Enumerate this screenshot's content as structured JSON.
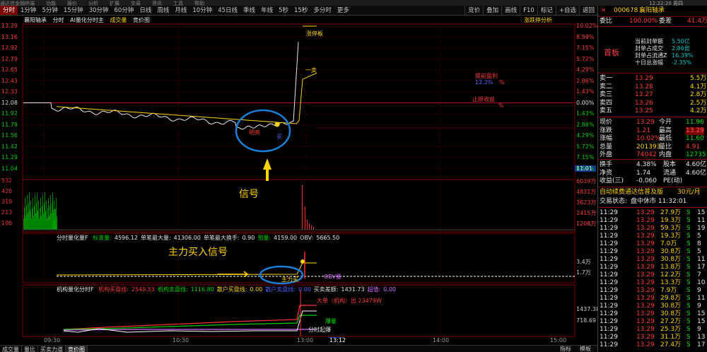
{
  "window": {
    "menu": [
      "通达信金融终端",
      "功能",
      "报价",
      "分析",
      "扩展",
      "交易",
      "资讯",
      "工具",
      "帮助"
    ],
    "clock": "12:22:20 周四"
  },
  "toolbar": {
    "periods": [
      "分时",
      "1分钟",
      "5分钟",
      "15分钟",
      "30分钟",
      "60分钟",
      "日线",
      "周线",
      "月线",
      "10分钟",
      "45日线",
      "季线",
      "年线",
      "5秒",
      "15秒",
      "多分时",
      "更多"
    ],
    "right_buttons": [
      "竞价",
      "叠加",
      "画线",
      "F10",
      "标记",
      "+自选",
      "返回"
    ]
  },
  "chart_header": {
    "name": "襄阳轴承",
    "mode": "分时",
    "indicator": "AI量化分时主",
    "volume_label": "成交量",
    "auction": "竞价图",
    "right_link": "涨跌停分析"
  },
  "price_axis_left": [
    "13.29",
    "13.16",
    "12.92",
    "12.79",
    "12.65",
    "12.43",
    "12.33",
    "12.08",
    "11.92",
    "11.79",
    "11.56",
    "11.42",
    "11.29",
    "11.04"
  ],
  "price_axis_right": [
    "10.02%",
    "8.59%",
    "7.15%",
    "5.72%",
    "4.29%",
    "2.86%",
    "1.43%",
    "0.00%",
    "1.43%",
    "2.86%",
    "4.29%",
    "5.72%",
    "7.15%",
    "8.59%"
  ],
  "price_cursor": "11.01",
  "volume_axis_left": [
    "532",
    "426",
    "319",
    "213",
    "106"
  ],
  "volume_axis_right": [
    "6039万",
    "4831万",
    "3623万",
    "2415万",
    "1208万"
  ],
  "chart_annotations": {
    "signal": "信号",
    "main_buy_signal": "主力买入信号",
    "bright_line": "明亮",
    "buy_mark": "买",
    "one_sell": "一卖",
    "limit_board": "涨停板",
    "up_limit_win": "提前盈利",
    "up_limit_pct": "12.2%",
    "up_limit_unit": "%",
    "dn_limit_win": "止损收益",
    "dn_limit_unit": "%"
  },
  "panel2": {
    "title": "分时量化量F",
    "fields": [
      {
        "label": "标准量:",
        "value": "4596.12"
      },
      {
        "label": "单笔最大量:",
        "value": "41306.00"
      },
      {
        "label": "单笔最大换手:",
        "value": "0.90"
      },
      {
        "label": "预量:",
        "value": "4159.00"
      },
      {
        "label": "OBV:",
        "value": "5665.50"
      }
    ],
    "axis_right": [
      "3.4万",
      "1.7万"
    ],
    "marks": {
      "main_buy": "主力买",
      "obv": "OBV量"
    }
  },
  "panel3": {
    "title": "机构量化分时F",
    "fields": [
      {
        "label": "机构买盘线:",
        "value": "2549.53"
      },
      {
        "label": "机构卖盘线:",
        "value": "1116.80"
      },
      {
        "label": "散户买盘线:",
        "value": "0.00"
      },
      {
        "label": "散户卖盘线:",
        "value": "0.00"
      },
      {
        "label": "买卖差额:",
        "value": "1431.73"
      },
      {
        "label": "超值:",
        "value": "0.00"
      }
    ],
    "axis_right": [
      "1437.38",
      "718.69"
    ],
    "marks": {
      "big_order": "大单（机构）出 23479W",
      "explode": "爆量",
      "break": "分时起爆"
    }
  },
  "time_axis": [
    "09:30",
    "10:30",
    "13:00",
    "13:12",
    "14:00",
    "15:00"
  ],
  "bottom_tabs": [
    "成交量",
    "量比",
    "买卖力道",
    "竞价图"
  ],
  "bottom_right": [
    "指标",
    "模板"
  ],
  "quote": {
    "code": "000678",
    "name": "襄阳轴承",
    "wei_bi_label": "委比",
    "wei_bi": "100.00%",
    "wei_cha_label": "委差",
    "wei_cha": "41.4万",
    "board_label": "首板",
    "seal_info": [
      {
        "label": "当前封单额",
        "value": "5.50亿"
      },
      {
        "label": "封单占成交",
        "value": "2.86倍"
      },
      {
        "label": "封单占流通Z",
        "value": "16.39%"
      },
      {
        "label": "十日总涨幅",
        "value": "-2.35%"
      }
    ],
    "sells": [
      {
        "label": "卖一",
        "price": "13.29",
        "vol": "5.5万"
      },
      {
        "label": "卖二",
        "price": "13.28",
        "vol": "4.1万"
      },
      {
        "label": "卖三",
        "price": "13.27",
        "vol": "2.8万"
      },
      {
        "label": "卖四",
        "price": "13.26",
        "vol": "2.5万"
      },
      {
        "label": "卖五",
        "price": "13.25",
        "vol": "4.2万"
      }
    ],
    "stats": [
      {
        "l1": "现价",
        "v1": "13.29",
        "l2": "今开",
        "v2": "11.96"
      },
      {
        "l1": "涨跌",
        "v1": "1.21",
        "l2": "最高",
        "v2": "13.29"
      },
      {
        "l1": "涨幅",
        "v1": "10.02%",
        "l2": "最低",
        "v2": "11.60"
      },
      {
        "l1": "总量",
        "v1": "201393",
        "l2": "量比",
        "v2": "4.91"
      },
      {
        "l1": "外盘",
        "v1": "74042",
        "l2": "内盘",
        "v2": "127351"
      }
    ],
    "stats2": [
      {
        "l1": "换手",
        "v1": "4.38%",
        "l2": "股本",
        "v2": "4.60亿"
      },
      {
        "l1": "净资",
        "v1": "1.74",
        "l2": "流通",
        "v2": "4.60亿"
      },
      {
        "l1": "收益(三)",
        "v1": "-0.060",
        "l2": "PE(动)",
        "v2": ""
      }
    ],
    "ad_text": "自动续费通达信普及版",
    "ad_price": "30元/月",
    "status_label": "交易状态:",
    "status": "盘中休市 11:32:01",
    "ticks": [
      {
        "t": "11:29",
        "p": "13.29",
        "v": "27.9万",
        "d": "S",
        "n": "15"
      },
      {
        "t": "11:29",
        "p": "13.29",
        "v": "19.3万",
        "d": "S",
        "n": "11"
      },
      {
        "t": "11:29",
        "p": "13.29",
        "v": "59.3万",
        "d": "S",
        "n": "19"
      },
      {
        "t": "11:29",
        "p": "13.29",
        "v": "19.3万",
        "d": "S",
        "n": "5"
      },
      {
        "t": "11:29",
        "p": "13.29",
        "v": "7.0万",
        "d": "S",
        "n": "8"
      },
      {
        "t": "11:29",
        "p": "13.29",
        "v": "30.8万",
        "d": "S",
        "n": "5"
      },
      {
        "t": "11:29",
        "p": "13.29",
        "v": "30.8万",
        "d": "S",
        "n": "11"
      },
      {
        "t": "11:29",
        "p": "13.29",
        "v": "13.8万",
        "d": "S",
        "n": "17"
      },
      {
        "t": "11:29",
        "p": "13.29",
        "v": "12.2万",
        "d": "S",
        "n": "7"
      },
      {
        "t": "11:29",
        "p": "13.29",
        "v": "13.3万",
        "d": "S",
        "n": "10"
      },
      {
        "t": "11:29",
        "p": "13.29",
        "v": "7.9万",
        "d": "S",
        "n": "9"
      },
      {
        "t": "11:29",
        "p": "13.29",
        "v": "29.8万",
        "d": "S",
        "n": "11"
      },
      {
        "t": "11:29",
        "p": "13.29",
        "v": "30.8万",
        "d": "S",
        "n": "9"
      },
      {
        "t": "11:29",
        "p": "13.29",
        "v": "30.8万",
        "d": "S",
        "n": "15"
      },
      {
        "t": "11:29",
        "p": "13.29",
        "v": "27.2万",
        "d": "S",
        "n": "15"
      },
      {
        "t": "11:29",
        "p": "13.29",
        "v": "25.3万",
        "d": "S",
        "n": "9"
      },
      {
        "t": "11:29",
        "p": "13.29",
        "v": "31.1万",
        "d": "S",
        "n": "13"
      },
      {
        "t": "11:29",
        "p": "13.29",
        "v": "27.4万",
        "d": "S",
        "n": "17"
      }
    ]
  }
}
